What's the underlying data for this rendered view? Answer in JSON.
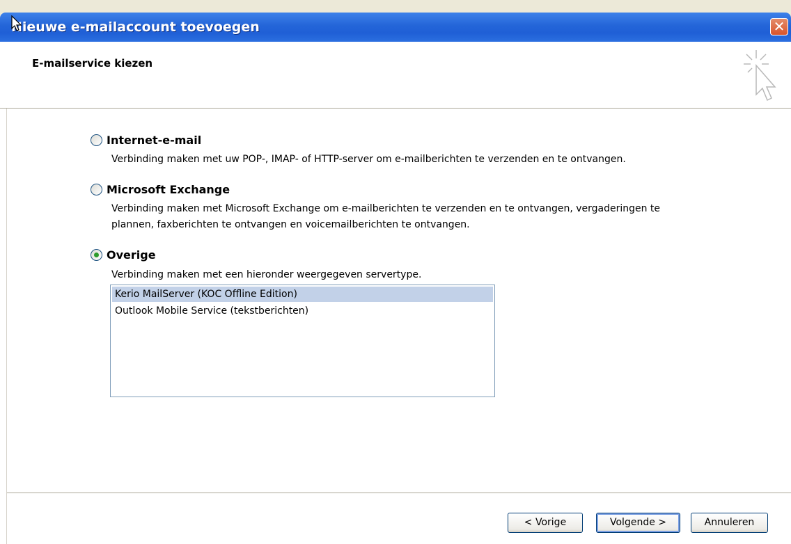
{
  "window": {
    "title": "Nieuwe e-mailaccount toevoegen",
    "close_symbol": "✕"
  },
  "header": {
    "title": "E-mailservice kiezen",
    "icon": "cursor-sparkle-icon"
  },
  "options": [
    {
      "label": "Internet-e-mail",
      "description": "Verbinding maken met uw POP-, IMAP- of HTTP-server om e-mailberichten te verzenden en te ontvangen.",
      "checked": false
    },
    {
      "label": "Microsoft Exchange",
      "description_line1": "Verbinding maken met Microsoft Exchange om e-mailberichten te verzenden en te ontvangen, vergaderingen te",
      "description_line2": "plannen, faxberichten te ontvangen en voicemailberichten te ontvangen.",
      "checked": false
    },
    {
      "label": "Overige",
      "description": "Verbinding maken met een hieronder weergegeven servertype.",
      "checked": true
    }
  ],
  "server_list": [
    {
      "label": "Kerio MailServer (KOC Offline Edition)",
      "selected": true
    },
    {
      "label": "Outlook Mobile Service (tekstberichten)",
      "selected": false
    }
  ],
  "buttons": {
    "back": "< Vorige",
    "next": "Volgende >",
    "cancel": "Annuleren"
  },
  "colors": {
    "titlebar": "#2465d8",
    "selection": "#c2d1e8",
    "radio_dot": "#2c9b2c"
  }
}
